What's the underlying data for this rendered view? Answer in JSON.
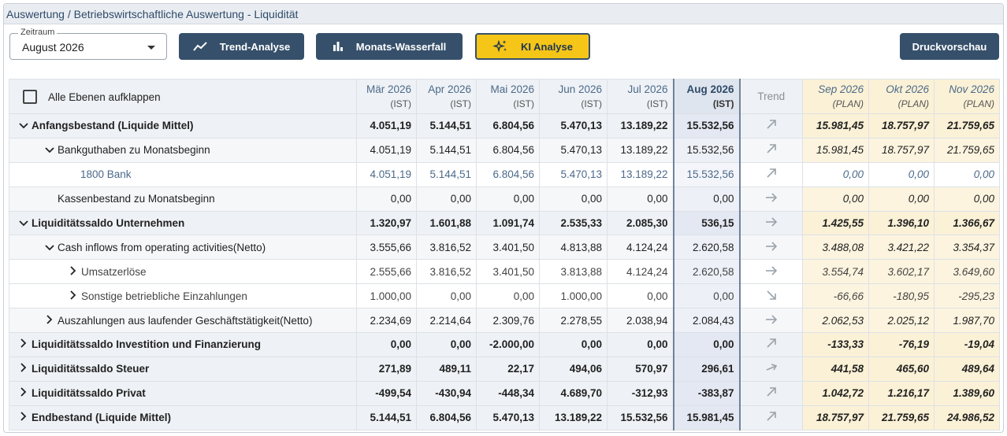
{
  "title": "Auswertung / Betriebswirtschaftliche Auswertung - Liquidität",
  "zeitraum": {
    "label": "Zeitraum",
    "value": "August 2026"
  },
  "buttons": {
    "trend": "Trend-Analyse",
    "wasserfall": "Monats-Wasserfall",
    "ki": "KI Analyse",
    "druck": "Druckvorschau"
  },
  "table": {
    "expand_all": "Alle Ebenen aufklappen",
    "trend_header": "Trend",
    "columns": [
      {
        "month": "Mär 2026",
        "kind": "(IST)"
      },
      {
        "month": "Apr 2026",
        "kind": "(IST)"
      },
      {
        "month": "Mai 2026",
        "kind": "(IST)"
      },
      {
        "month": "Jun 2026",
        "kind": "(IST)"
      },
      {
        "month": "Jul 2026",
        "kind": "(IST)"
      },
      {
        "month": "Aug 2026",
        "kind": "(IST)"
      }
    ],
    "plan_columns": [
      {
        "month": "Sep 2026",
        "kind": "(PLAN)"
      },
      {
        "month": "Okt 2026",
        "kind": "(PLAN)"
      },
      {
        "month": "Nov 2026",
        "kind": "(PLAN)"
      }
    ],
    "rows": [
      {
        "label": "Anfangsbestand (Liquide Mittel)",
        "level": 0,
        "chevron": "down",
        "ist": [
          "4.051,19",
          "5.144,51",
          "6.804,56",
          "5.470,13",
          "13.189,22",
          "15.532,56"
        ],
        "trend": "up",
        "plan": [
          "15.981,45",
          "18.757,97",
          "21.759,65"
        ]
      },
      {
        "label": "Bankguthaben zu Monatsbeginn",
        "level": 1,
        "chevron": "down",
        "ist": [
          "4.051,19",
          "5.144,51",
          "6.804,56",
          "5.470,13",
          "13.189,22",
          "15.532,56"
        ],
        "trend": "up",
        "plan": [
          "15.981,45",
          "18.757,97",
          "21.759,65"
        ]
      },
      {
        "label": "1800 Bank",
        "level": 3,
        "chevron": "",
        "ist": [
          "4.051,19",
          "5.144,51",
          "6.804,56",
          "5.470,13",
          "13.189,22",
          "15.532,56"
        ],
        "trend": "up",
        "plan": [
          "0,00",
          "0,00",
          "0,00"
        ]
      },
      {
        "label": "Kassenbestand zu Monatsbeginn",
        "level": 1,
        "chevron": "",
        "ist": [
          "0,00",
          "0,00",
          "0,00",
          "0,00",
          "0,00",
          "0,00"
        ],
        "trend": "flat",
        "plan": [
          "0,00",
          "0,00",
          "0,00"
        ]
      },
      {
        "label": "Liquiditätssaldo Unternehmen",
        "level": 0,
        "chevron": "down",
        "ist": [
          "1.320,97",
          "1.601,88",
          "1.091,74",
          "2.535,33",
          "2.085,30",
          "536,15"
        ],
        "trend": "flat",
        "plan": [
          "1.425,55",
          "1.396,10",
          "1.366,67"
        ]
      },
      {
        "label": "Cash inflows from operating activities(Netto)",
        "level": 1,
        "chevron": "down",
        "ist": [
          "3.555,66",
          "3.816,52",
          "3.401,50",
          "4.813,88",
          "4.124,24",
          "2.620,58"
        ],
        "trend": "flat",
        "plan": [
          "3.488,08",
          "3.421,22",
          "3.354,37"
        ]
      },
      {
        "label": "Umsatzerlöse",
        "level": 2,
        "chevron": "right",
        "ist": [
          "2.555,66",
          "3.816,52",
          "3.401,50",
          "3.813,88",
          "4.124,24",
          "2.620,58"
        ],
        "trend": "flat",
        "plan": [
          "3.554,74",
          "3.602,17",
          "3.649,60"
        ]
      },
      {
        "label": "Sonstige betriebliche Einzahlungen",
        "level": 2,
        "chevron": "right",
        "ist": [
          "1.000,00",
          "0,00",
          "0,00",
          "1.000,00",
          "0,00",
          "0,00"
        ],
        "trend": "down",
        "plan": [
          "-66,66",
          "-180,95",
          "-295,23"
        ]
      },
      {
        "label": "Auszahlungen aus laufender Geschäftstätigkeit(Netto)",
        "level": 1,
        "chevron": "right",
        "ist": [
          "2.234,69",
          "2.214,64",
          "2.309,76",
          "2.278,55",
          "2.038,94",
          "2.084,43"
        ],
        "trend": "flat",
        "plan": [
          "2.062,53",
          "2.025,12",
          "1.987,70"
        ]
      },
      {
        "label": "Liquiditätssaldo Investition und Finanzierung",
        "level": 0,
        "chevron": "right",
        "ist": [
          "0,00",
          "0,00",
          "-2.000,00",
          "0,00",
          "0,00",
          "0,00"
        ],
        "trend": "up",
        "plan": [
          "-133,33",
          "-76,19",
          "-19,04"
        ]
      },
      {
        "label": "Liquiditätssaldo Steuer",
        "level": 0,
        "chevron": "right",
        "ist": [
          "271,89",
          "489,11",
          "22,17",
          "494,06",
          "570,97",
          "296,61"
        ],
        "trend": "slight-up",
        "plan": [
          "441,58",
          "465,60",
          "489,64"
        ]
      },
      {
        "label": "Liquiditätssaldo Privat",
        "level": 0,
        "chevron": "right",
        "ist": [
          "-499,54",
          "-430,94",
          "-448,34",
          "4.689,70",
          "-312,93",
          "-383,87"
        ],
        "trend": "up",
        "plan": [
          "1.042,72",
          "1.216,17",
          "1.389,60"
        ]
      },
      {
        "label": "Endbestand (Liquide Mittel)",
        "level": 0,
        "chevron": "right",
        "ist": [
          "5.144,51",
          "6.804,56",
          "5.470,13",
          "13.189,22",
          "15.532,56",
          "15.981,45"
        ],
        "trend": "up",
        "plan": [
          "18.757,97",
          "21.759,65",
          "24.986,52"
        ]
      }
    ]
  },
  "colors": {
    "button": "#36506b",
    "ki_button": "#f5c518",
    "plan_bg": "#fcf4df",
    "header_bg": "#eef1f5",
    "account_text": "#4b6a8a"
  }
}
